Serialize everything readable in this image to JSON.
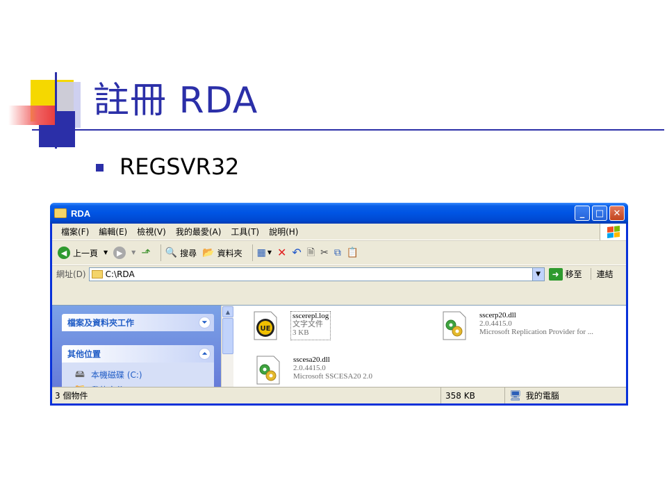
{
  "slide": {
    "title": "註冊 RDA",
    "bullet": "REGSVR32"
  },
  "window": {
    "title": "RDA",
    "buttons": {
      "minimize": "_",
      "maximize": "□",
      "close": "✕"
    },
    "menu": [
      "檔案(F)",
      "編輯(E)",
      "檢視(V)",
      "我的最愛(A)",
      "工具(T)",
      "說明(H)"
    ],
    "toolbar": {
      "back": "上一頁",
      "search": "搜尋",
      "folders": "資料夾"
    },
    "address": {
      "label": "網址(D)",
      "value": "C:\\RDA",
      "go": "移至",
      "links": "連結"
    },
    "taskpane": {
      "section1": "檔案及資料夾工作",
      "section2": "其他位置",
      "items": [
        "本機磁碟 (C:)",
        "我的文件"
      ]
    },
    "files": [
      {
        "name": "sscerepl.log",
        "line2": "文字文件",
        "line3": "3 KB",
        "icon": "ultraedit-icon"
      },
      {
        "name": "sscerp20.dll",
        "line2": "2.0.4415.0",
        "line3": "Microsoft Replication Provider for ...",
        "icon": "dll-icon"
      },
      {
        "name": "sscesa20.dll",
        "line2": "2.0.4415.0",
        "line3": "Microsoft SSCESA20 2.0",
        "icon": "dll-icon"
      }
    ],
    "status": {
      "count": "3 個物件",
      "size": "358 KB",
      "location": "我的電腦"
    }
  },
  "colors": {
    "accent": "#2b2fa8",
    "deco_yellow": "#f5d800",
    "deco_red": "#e83a3a",
    "xp_title_blue": "#0054e3",
    "xp_face": "#ece9d8"
  }
}
